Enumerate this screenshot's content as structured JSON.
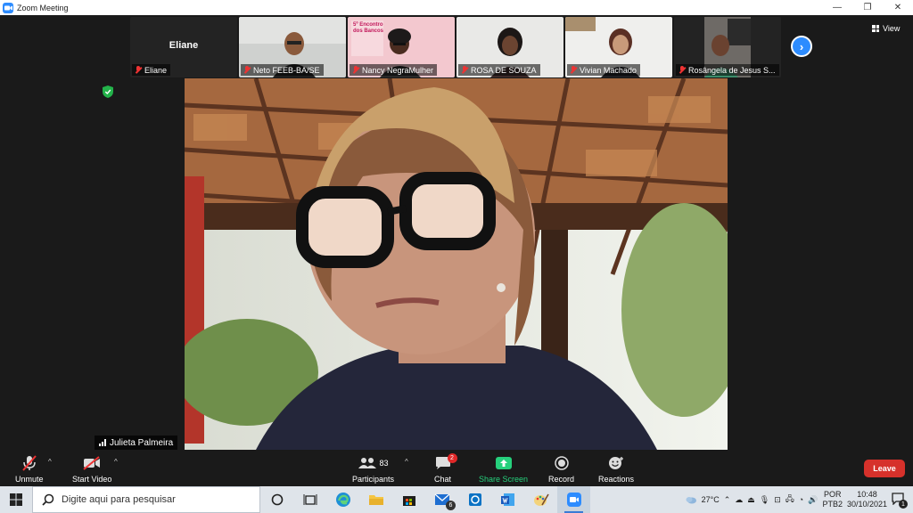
{
  "window": {
    "title": "Zoom Meeting",
    "minimize": "—",
    "restore": "❐",
    "close": "✕"
  },
  "thumbnails": [
    {
      "name": "Eliane",
      "label": "Eliane"
    },
    {
      "name": "Neto  FEEB-BA/SE"
    },
    {
      "name": "Nancy NegraMulher"
    },
    {
      "name": "ROSA DE SOUZA"
    },
    {
      "name": "Vivian Machado"
    },
    {
      "name": "Rosângela de Jesus S..."
    }
  ],
  "poster_text": "5º Encontro dos Bancos",
  "view_label": "View",
  "speaker": {
    "name": "Julieta Palmeira"
  },
  "toolbar": {
    "unmute": "Unmute",
    "start_video": "Start Video",
    "participants": "Participants",
    "participant_count": "83",
    "chat": "Chat",
    "chat_badge": "2",
    "share_screen": "Share Screen",
    "record": "Record",
    "reactions": "Reactions",
    "leave": "Leave"
  },
  "taskbar": {
    "search_placeholder": "Digite aqui para pesquisar",
    "mail_badge": "6",
    "weather": "27°C",
    "lang_top": "POR",
    "lang_bottom": "PTB2",
    "time": "10:48",
    "date": "30/10/2021",
    "notif_count": "1"
  },
  "colors": {
    "accent": "#2d8cff",
    "leave": "#d6312b",
    "share": "#26d07c"
  }
}
